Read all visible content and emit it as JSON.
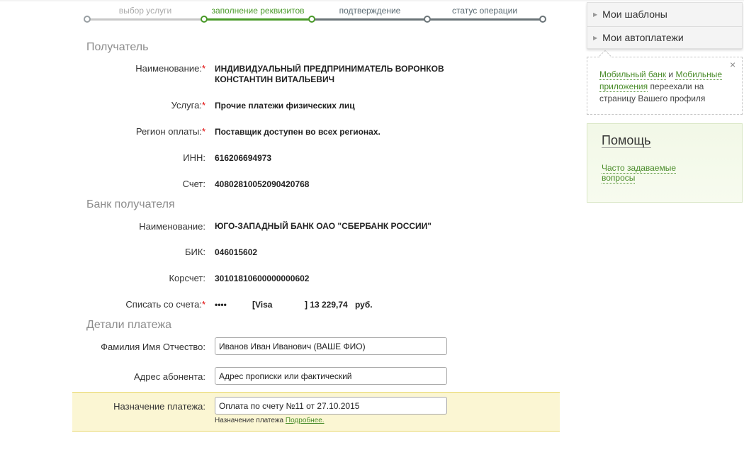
{
  "stepper": {
    "steps": [
      {
        "label": "выбор услуги",
        "state": "done"
      },
      {
        "label": "заполнение реквизитов",
        "state": "current"
      },
      {
        "label": "подтверждение",
        "state": "pending"
      },
      {
        "label": "статус операции",
        "state": "pending"
      }
    ],
    "colors": {
      "done": "#c8c8c8",
      "current": "#4a9a2a",
      "pending": "#6b7478"
    }
  },
  "recipient": {
    "title": "Получатель",
    "name_label": "Наименование:",
    "name_value": "ИНДИВИДУАЛЬНЫЙ ПРЕДПРИНИМАТЕЛЬ ВОРОНКОВ КОНСТАНТИН ВИТАЛЬЕВИЧ",
    "service_label": "Услуга:",
    "service_value": "Прочие платежи физических лиц",
    "region_label": "Регион оплаты:",
    "region_value": "Поставщик доступен во всех регионах.",
    "inn_label": "ИНН:",
    "inn_value": "616206694973",
    "account_label": "Счет:",
    "account_value": "40802810052090420768"
  },
  "bank": {
    "title": "Банк получателя",
    "name_label": "Наименование:",
    "name_value": "ЮГО-ЗАПАДНЫЙ БАНК ОАО \"СБЕРБАНК РОССИИ\"",
    "bik_label": "БИК:",
    "bik_value": "046015602",
    "corr_label": "Корсчет:",
    "corr_value": "30101810600000000602",
    "debit_label": "Списать со счета:",
    "debit_mask": "••••",
    "debit_card": "[Visa",
    "debit_amount": "] 13 229,74",
    "debit_currency": "руб."
  },
  "details": {
    "title": "Детали платежа",
    "fio_label": "Фамилия Имя Отчество:",
    "fio_value": "Иванов Иван Иванович (ВАШЕ ФИО)",
    "address_label": "Адрес абонента:",
    "address_value": "Адрес прописки или фактический",
    "purpose_label": "Назначение платежа:",
    "purpose_value": "Оплата по счету №11 от 27.10.2015",
    "hint_text": "Назначение платежа",
    "hint_link": "Подробнее."
  },
  "required_mark": "*",
  "sidebar": {
    "menu": [
      {
        "label": "Мои шаблоны"
      },
      {
        "label": "Мои автоплатежи"
      }
    ],
    "notice": {
      "link1": "Мобильный банк",
      "and": "и",
      "link2": "Мобильные приложения",
      "text": "переехали на страницу Вашего профиля",
      "close": "×"
    },
    "help": {
      "title": "Помощь",
      "faq_line1": "Часто задаваемые",
      "faq_line2": "вопросы"
    }
  }
}
